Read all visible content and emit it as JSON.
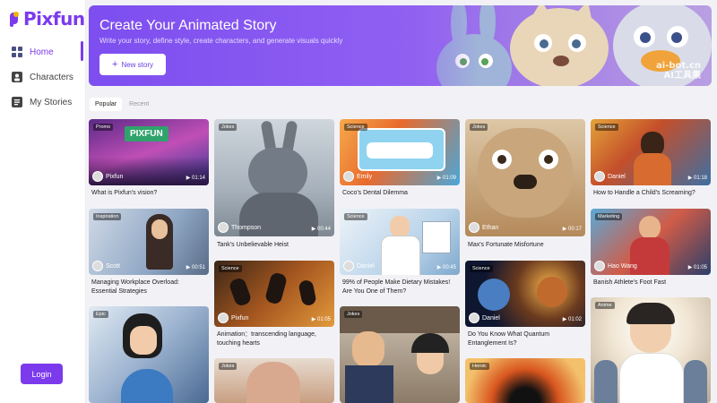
{
  "app": {
    "name": "Pixfun"
  },
  "nav": [
    {
      "label": "Home",
      "icon": "grid-icon",
      "active": true
    },
    {
      "label": "Characters",
      "icon": "person-icon",
      "active": false
    },
    {
      "label": "My Stories",
      "icon": "book-icon",
      "active": false
    }
  ],
  "login_label": "Login",
  "hero": {
    "title": "Create Your Animated Story",
    "subtitle": "Write your story, define style, create characters, and generate visuals quickly",
    "button_label": "New story",
    "watermark": "ai-bot.cn\nAI工具集"
  },
  "tabs": [
    {
      "label": "Popular",
      "active": true
    },
    {
      "label": "Recent",
      "active": false
    }
  ],
  "cards": [
    {
      "tag": "Promo",
      "author": "Pixfun",
      "duration": "01:14",
      "title": "What is Pixfun's vision?",
      "banner": "PIXFUN"
    },
    {
      "tag": "Inspiration",
      "author": "Scott",
      "duration": "00:51",
      "title": "Managing Workplace Overload: Essential Strategies"
    },
    {
      "tag": "Epic",
      "author": "",
      "duration": "",
      "title": ""
    },
    {
      "tag": "Jokes",
      "author": "Thompson",
      "duration": "00:44",
      "title": "Tank's Unbelievable Heist"
    },
    {
      "tag": "Science",
      "author": "Pixfun",
      "duration": "01:05",
      "title": "Animation：transcending language, touching hearts"
    },
    {
      "tag": "Jokes",
      "author": "",
      "duration": "",
      "title": ""
    },
    {
      "tag": "Science",
      "author": "Emily",
      "duration": "01:09",
      "title": "Coco's Dental Dilemma"
    },
    {
      "tag": "Science",
      "author": "Daniel",
      "duration": "00:45",
      "title": "99% of People Make Dietary Mistakes! Are You One of Them?"
    },
    {
      "tag": "Jokes",
      "author": "",
      "duration": "",
      "title": ""
    },
    {
      "tag": "Jokes",
      "author": "Ethan",
      "duration": "00:17",
      "title": "Max's Fortunate Misfortune"
    },
    {
      "tag": "Science",
      "author": "Daniel",
      "duration": "01:02",
      "title": "Do You Know What Quantum Entanglement Is?"
    },
    {
      "tag": "Heroic",
      "author": "",
      "duration": "",
      "title": ""
    },
    {
      "tag": "Science",
      "author": "Daniel",
      "duration": "01:18",
      "title": "How to Handle a Child's Screaming?"
    },
    {
      "tag": "Marketing",
      "author": "Hao Wang",
      "duration": "01:05",
      "title": "Banish Athlete's Foot Fast"
    },
    {
      "tag": "Anime",
      "author": "",
      "duration": "",
      "title": ""
    }
  ]
}
